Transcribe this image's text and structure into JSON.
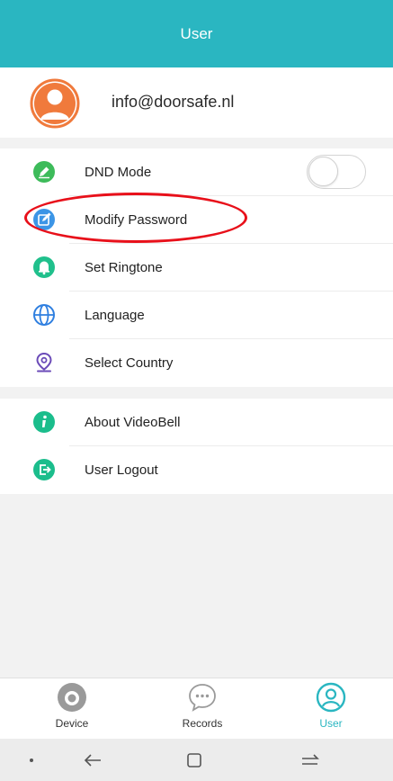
{
  "header": {
    "title": "User"
  },
  "profile": {
    "email": "info@doorsafe.nl",
    "avatar_icon": "user-avatar-icon"
  },
  "menu_group_1": [
    {
      "label": "DND Mode",
      "icon": "dnd-icon",
      "icon_color": "#3dbb5a",
      "toggle_on": false
    },
    {
      "label": "Modify Password",
      "icon": "edit-icon",
      "icon_color": "#3c95e6"
    },
    {
      "label": "Set Ringtone",
      "icon": "bell-icon",
      "icon_color": "#20c08c"
    },
    {
      "label": "Language",
      "icon": "globe-icon",
      "icon_color": "#2f7fe0"
    },
    {
      "label": "Select Country",
      "icon": "location-pin-icon",
      "icon_color": "#6b4bb8"
    }
  ],
  "menu_group_2": [
    {
      "label": "About VideoBell",
      "icon": "info-icon",
      "icon_color": "#1bbd8c"
    },
    {
      "label": "User Logout",
      "icon": "logout-icon",
      "icon_color": "#1bbd8c"
    }
  ],
  "tabs": [
    {
      "label": "Device",
      "icon": "camera-icon",
      "active": false
    },
    {
      "label": "Records",
      "icon": "chat-bubble-icon",
      "active": false
    },
    {
      "label": "User",
      "icon": "user-icon",
      "active": true
    }
  ],
  "colors": {
    "accent": "#2ab6c1",
    "highlight_ring": "#e8101a"
  }
}
